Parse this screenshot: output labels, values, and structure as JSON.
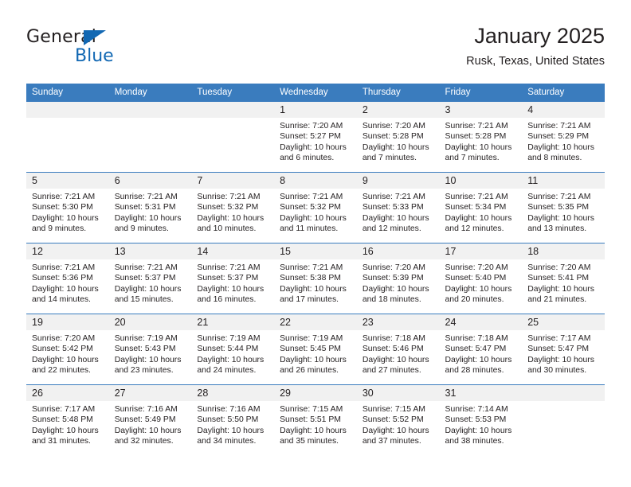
{
  "brand": {
    "word1": "General",
    "word2": "Blue",
    "accent": "#1268b3"
  },
  "header": {
    "title": "January 2025",
    "subtitle": "Rusk, Texas, United States"
  },
  "theme": {
    "header_blue": "#3a7cbe",
    "daynum_bg": "#f1f1f1",
    "text": "#231f20"
  },
  "weekdays": [
    "Sunday",
    "Monday",
    "Tuesday",
    "Wednesday",
    "Thursday",
    "Friday",
    "Saturday"
  ],
  "labels": {
    "sunrise_prefix": "Sunrise:",
    "sunset_prefix": "Sunset:",
    "daylight_prefix": "Daylight:"
  },
  "weeks": [
    [
      {
        "day": "",
        "empty": true
      },
      {
        "day": "",
        "empty": true
      },
      {
        "day": "",
        "empty": true
      },
      {
        "day": "1",
        "sunrise": "Sunrise: 7:20 AM",
        "sunset": "Sunset: 5:27 PM",
        "daylight_1": "Daylight: 10 hours",
        "daylight_2": "and 6 minutes."
      },
      {
        "day": "2",
        "sunrise": "Sunrise: 7:20 AM",
        "sunset": "Sunset: 5:28 PM",
        "daylight_1": "Daylight: 10 hours",
        "daylight_2": "and 7 minutes."
      },
      {
        "day": "3",
        "sunrise": "Sunrise: 7:21 AM",
        "sunset": "Sunset: 5:28 PM",
        "daylight_1": "Daylight: 10 hours",
        "daylight_2": "and 7 minutes."
      },
      {
        "day": "4",
        "sunrise": "Sunrise: 7:21 AM",
        "sunset": "Sunset: 5:29 PM",
        "daylight_1": "Daylight: 10 hours",
        "daylight_2": "and 8 minutes."
      }
    ],
    [
      {
        "day": "5",
        "sunrise": "Sunrise: 7:21 AM",
        "sunset": "Sunset: 5:30 PM",
        "daylight_1": "Daylight: 10 hours",
        "daylight_2": "and 9 minutes."
      },
      {
        "day": "6",
        "sunrise": "Sunrise: 7:21 AM",
        "sunset": "Sunset: 5:31 PM",
        "daylight_1": "Daylight: 10 hours",
        "daylight_2": "and 9 minutes."
      },
      {
        "day": "7",
        "sunrise": "Sunrise: 7:21 AM",
        "sunset": "Sunset: 5:32 PM",
        "daylight_1": "Daylight: 10 hours",
        "daylight_2": "and 10 minutes."
      },
      {
        "day": "8",
        "sunrise": "Sunrise: 7:21 AM",
        "sunset": "Sunset: 5:32 PM",
        "daylight_1": "Daylight: 10 hours",
        "daylight_2": "and 11 minutes."
      },
      {
        "day": "9",
        "sunrise": "Sunrise: 7:21 AM",
        "sunset": "Sunset: 5:33 PM",
        "daylight_1": "Daylight: 10 hours",
        "daylight_2": "and 12 minutes."
      },
      {
        "day": "10",
        "sunrise": "Sunrise: 7:21 AM",
        "sunset": "Sunset: 5:34 PM",
        "daylight_1": "Daylight: 10 hours",
        "daylight_2": "and 12 minutes."
      },
      {
        "day": "11",
        "sunrise": "Sunrise: 7:21 AM",
        "sunset": "Sunset: 5:35 PM",
        "daylight_1": "Daylight: 10 hours",
        "daylight_2": "and 13 minutes."
      }
    ],
    [
      {
        "day": "12",
        "sunrise": "Sunrise: 7:21 AM",
        "sunset": "Sunset: 5:36 PM",
        "daylight_1": "Daylight: 10 hours",
        "daylight_2": "and 14 minutes."
      },
      {
        "day": "13",
        "sunrise": "Sunrise: 7:21 AM",
        "sunset": "Sunset: 5:37 PM",
        "daylight_1": "Daylight: 10 hours",
        "daylight_2": "and 15 minutes."
      },
      {
        "day": "14",
        "sunrise": "Sunrise: 7:21 AM",
        "sunset": "Sunset: 5:37 PM",
        "daylight_1": "Daylight: 10 hours",
        "daylight_2": "and 16 minutes."
      },
      {
        "day": "15",
        "sunrise": "Sunrise: 7:21 AM",
        "sunset": "Sunset: 5:38 PM",
        "daylight_1": "Daylight: 10 hours",
        "daylight_2": "and 17 minutes."
      },
      {
        "day": "16",
        "sunrise": "Sunrise: 7:20 AM",
        "sunset": "Sunset: 5:39 PM",
        "daylight_1": "Daylight: 10 hours",
        "daylight_2": "and 18 minutes."
      },
      {
        "day": "17",
        "sunrise": "Sunrise: 7:20 AM",
        "sunset": "Sunset: 5:40 PM",
        "daylight_1": "Daylight: 10 hours",
        "daylight_2": "and 20 minutes."
      },
      {
        "day": "18",
        "sunrise": "Sunrise: 7:20 AM",
        "sunset": "Sunset: 5:41 PM",
        "daylight_1": "Daylight: 10 hours",
        "daylight_2": "and 21 minutes."
      }
    ],
    [
      {
        "day": "19",
        "sunrise": "Sunrise: 7:20 AM",
        "sunset": "Sunset: 5:42 PM",
        "daylight_1": "Daylight: 10 hours",
        "daylight_2": "and 22 minutes."
      },
      {
        "day": "20",
        "sunrise": "Sunrise: 7:19 AM",
        "sunset": "Sunset: 5:43 PM",
        "daylight_1": "Daylight: 10 hours",
        "daylight_2": "and 23 minutes."
      },
      {
        "day": "21",
        "sunrise": "Sunrise: 7:19 AM",
        "sunset": "Sunset: 5:44 PM",
        "daylight_1": "Daylight: 10 hours",
        "daylight_2": "and 24 minutes."
      },
      {
        "day": "22",
        "sunrise": "Sunrise: 7:19 AM",
        "sunset": "Sunset: 5:45 PM",
        "daylight_1": "Daylight: 10 hours",
        "daylight_2": "and 26 minutes."
      },
      {
        "day": "23",
        "sunrise": "Sunrise: 7:18 AM",
        "sunset": "Sunset: 5:46 PM",
        "daylight_1": "Daylight: 10 hours",
        "daylight_2": "and 27 minutes."
      },
      {
        "day": "24",
        "sunrise": "Sunrise: 7:18 AM",
        "sunset": "Sunset: 5:47 PM",
        "daylight_1": "Daylight: 10 hours",
        "daylight_2": "and 28 minutes."
      },
      {
        "day": "25",
        "sunrise": "Sunrise: 7:17 AM",
        "sunset": "Sunset: 5:47 PM",
        "daylight_1": "Daylight: 10 hours",
        "daylight_2": "and 30 minutes."
      }
    ],
    [
      {
        "day": "26",
        "sunrise": "Sunrise: 7:17 AM",
        "sunset": "Sunset: 5:48 PM",
        "daylight_1": "Daylight: 10 hours",
        "daylight_2": "and 31 minutes."
      },
      {
        "day": "27",
        "sunrise": "Sunrise: 7:16 AM",
        "sunset": "Sunset: 5:49 PM",
        "daylight_1": "Daylight: 10 hours",
        "daylight_2": "and 32 minutes."
      },
      {
        "day": "28",
        "sunrise": "Sunrise: 7:16 AM",
        "sunset": "Sunset: 5:50 PM",
        "daylight_1": "Daylight: 10 hours",
        "daylight_2": "and 34 minutes."
      },
      {
        "day": "29",
        "sunrise": "Sunrise: 7:15 AM",
        "sunset": "Sunset: 5:51 PM",
        "daylight_1": "Daylight: 10 hours",
        "daylight_2": "and 35 minutes."
      },
      {
        "day": "30",
        "sunrise": "Sunrise: 7:15 AM",
        "sunset": "Sunset: 5:52 PM",
        "daylight_1": "Daylight: 10 hours",
        "daylight_2": "and 37 minutes."
      },
      {
        "day": "31",
        "sunrise": "Sunrise: 7:14 AM",
        "sunset": "Sunset: 5:53 PM",
        "daylight_1": "Daylight: 10 hours",
        "daylight_2": "and 38 minutes."
      },
      {
        "day": "",
        "empty": true
      }
    ]
  ]
}
